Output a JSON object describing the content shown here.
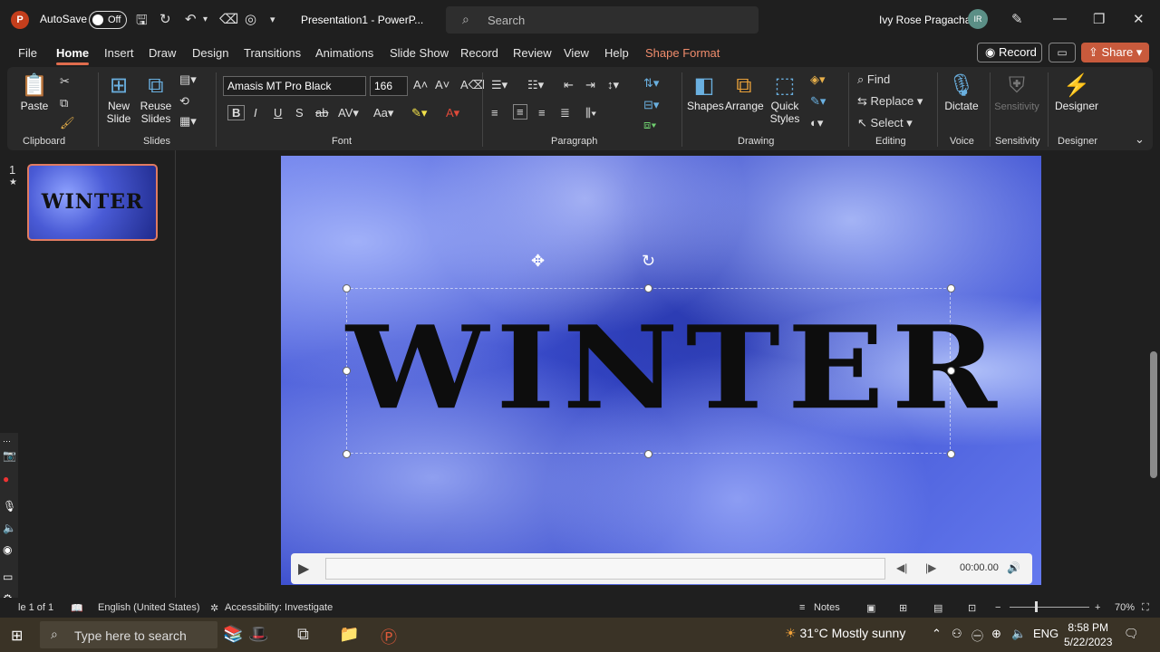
{
  "titlebar": {
    "logo": "P",
    "autosave_label": "AutoSave",
    "autosave_state": "Off",
    "doc_title": "Presentation1 - PowerP...",
    "search_placeholder": "Search",
    "user_name": "Ivy Rose Pragacha",
    "user_initials": "IR"
  },
  "menu": {
    "tabs": [
      "File",
      "Home",
      "Insert",
      "Draw",
      "Design",
      "Transitions",
      "Animations",
      "Slide Show",
      "Record",
      "Review",
      "View",
      "Help",
      "Shape Format"
    ],
    "active_tab": "Home",
    "record_label": "Record",
    "share_label": "Share"
  },
  "ribbon": {
    "clipboard": {
      "paste": "Paste",
      "group": "Clipboard"
    },
    "slides": {
      "new_slide": "New Slide",
      "reuse_slides": "Reuse Slides",
      "group": "Slides"
    },
    "font": {
      "font_name": "Amasis MT Pro Black",
      "font_size": "166",
      "group": "Font"
    },
    "paragraph": {
      "group": "Paragraph"
    },
    "drawing": {
      "shapes": "Shapes",
      "arrange": "Arrange",
      "quick_styles": "Quick Styles",
      "group": "Drawing"
    },
    "editing": {
      "find": "Find",
      "replace": "Replace",
      "select": "Select",
      "group": "Editing"
    },
    "voice": {
      "dictate": "Dictate",
      "group": "Voice"
    },
    "sensitivity": {
      "label": "Sensitivity",
      "group": "Sensitivity"
    },
    "designer": {
      "label": "Designer",
      "group": "Designer"
    }
  },
  "thumbnails": {
    "slide_number": "1",
    "thumb_text": "WINTER"
  },
  "slide": {
    "title_text": "WINTER",
    "media_time": "00:00.00"
  },
  "status": {
    "slide_info": "le 1 of 1",
    "language": "English (United States)",
    "accessibility": "Accessibility: Investigate",
    "notes": "Notes",
    "zoom": "70%"
  },
  "taskbar": {
    "search_placeholder": "Type here to search",
    "weather": "31°C  Mostly sunny",
    "language": "ENG",
    "time": "8:58 PM",
    "date": "5/22/2023"
  }
}
